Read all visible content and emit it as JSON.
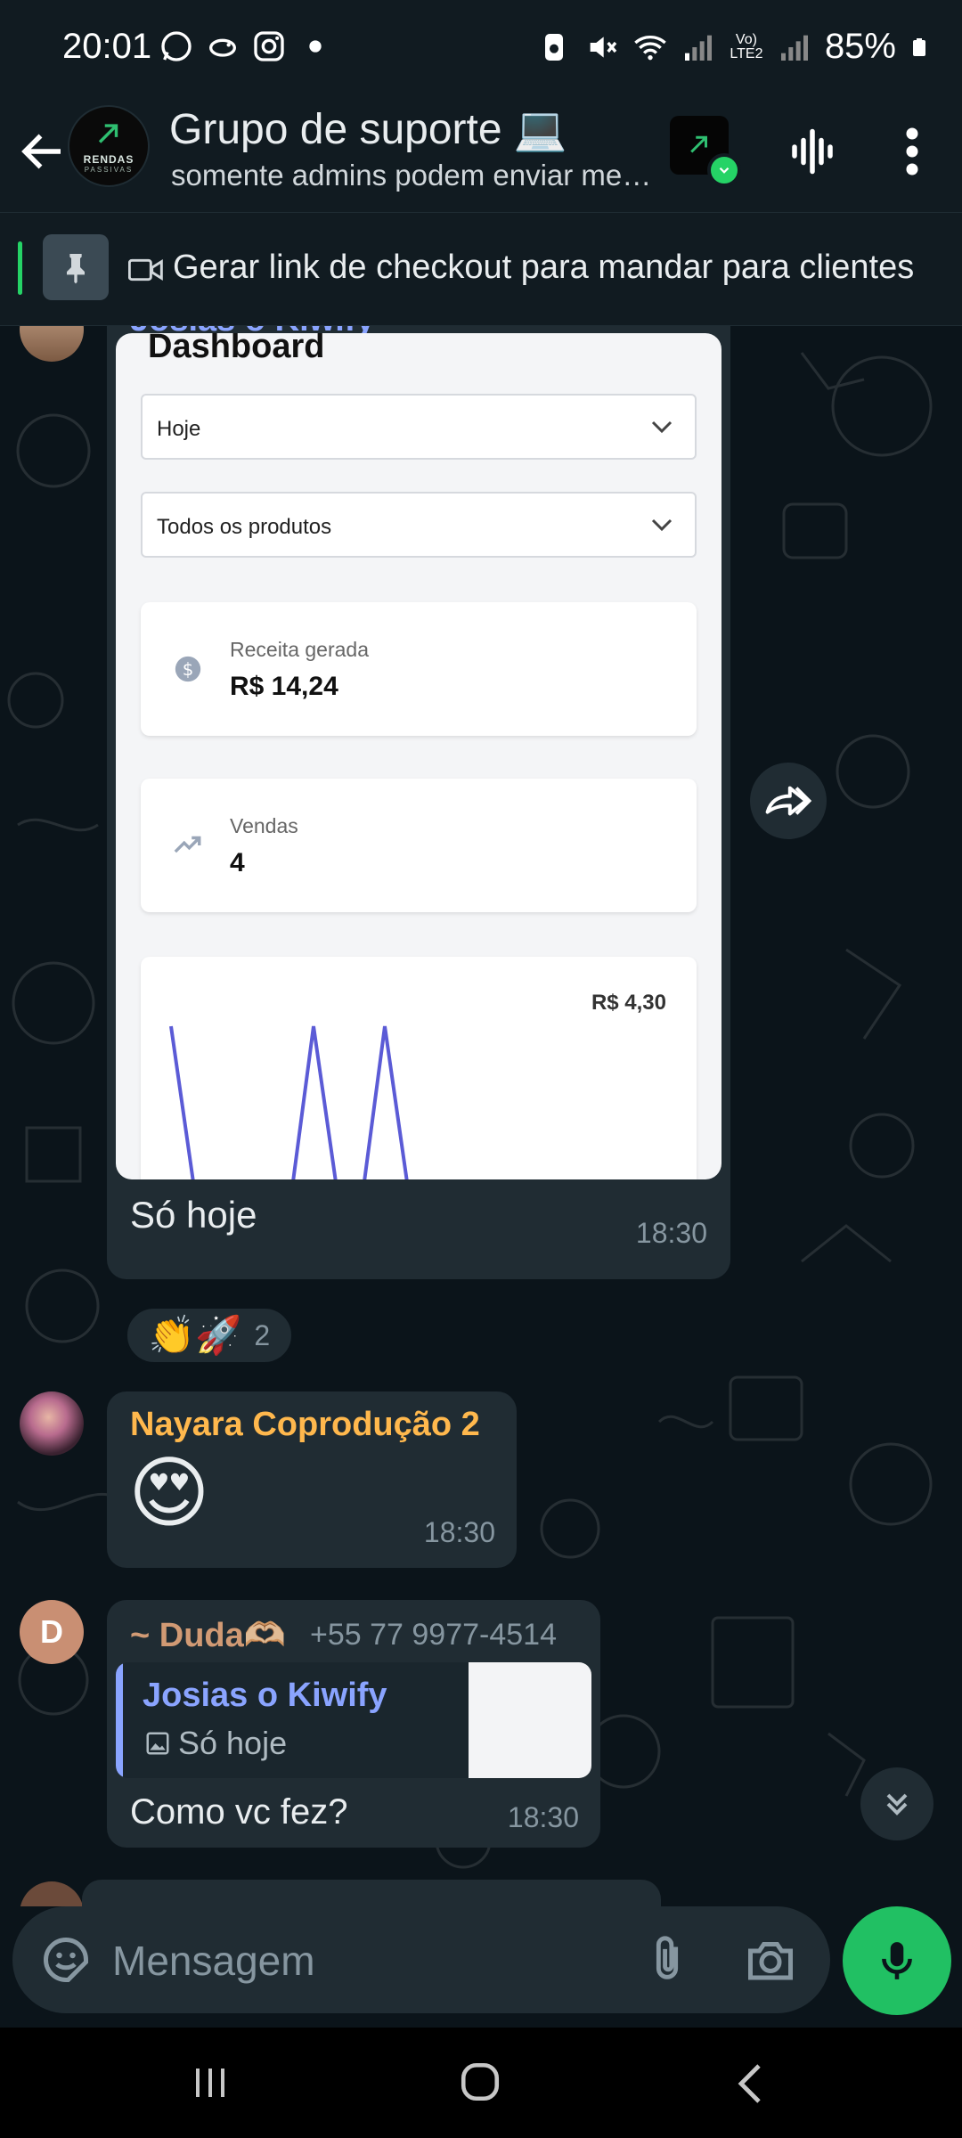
{
  "status_bar": {
    "time": "20:01",
    "battery": "85%",
    "network_label": "Vo) LTE2",
    "icons": [
      "whatsapp-icon",
      "bird-icon",
      "instagram-icon",
      "dot-icon",
      "alarm-icon",
      "mute-icon",
      "wifi-icon",
      "signal-icon",
      "battery-icon"
    ]
  },
  "header": {
    "title": "Grupo de suporte 💻",
    "subtitle": "somente admins podem enviar mensagens",
    "avatar_logo_text": "RENDAS",
    "avatar_logo_sub": "PASSIVAS"
  },
  "pinned": {
    "text": "Gerar link de checkout para mandar para clientes"
  },
  "messages": [
    {
      "author": "Josias o Kiwify",
      "author_color": "#8aa4ff",
      "caption": "Só hoje",
      "time": "18:30",
      "reactions": {
        "emojis": "👏🚀",
        "count": "2"
      },
      "image": {
        "title": "Dashboard",
        "select_period": "Hoje",
        "select_products": "Todos os produtos",
        "revenue_label": "Receita gerada",
        "revenue_value": "R$ 14,24",
        "sales_label": "Vendas",
        "sales_value": "4",
        "chart_max_label": "R$ 4,30",
        "line_color": "#5b5bd6"
      }
    },
    {
      "author": "Nayara Coprodução 2",
      "author_color": "#ffb84d",
      "emoji": "😍",
      "time": "18:30"
    },
    {
      "author": "~ Duda🫶🏼",
      "author_color": "#d19a74",
      "avatar_letter": "D",
      "phone": "+55 77 9977-4514",
      "quote": {
        "author": "Josias o Kiwify",
        "text": "Só hoje"
      },
      "text": "Como vc fez?",
      "time": "18:30"
    }
  ],
  "composer": {
    "placeholder": "Mensagem"
  },
  "colors": {
    "accent": "#25d366",
    "bubble": "#202c33",
    "background": "#0b141a"
  }
}
